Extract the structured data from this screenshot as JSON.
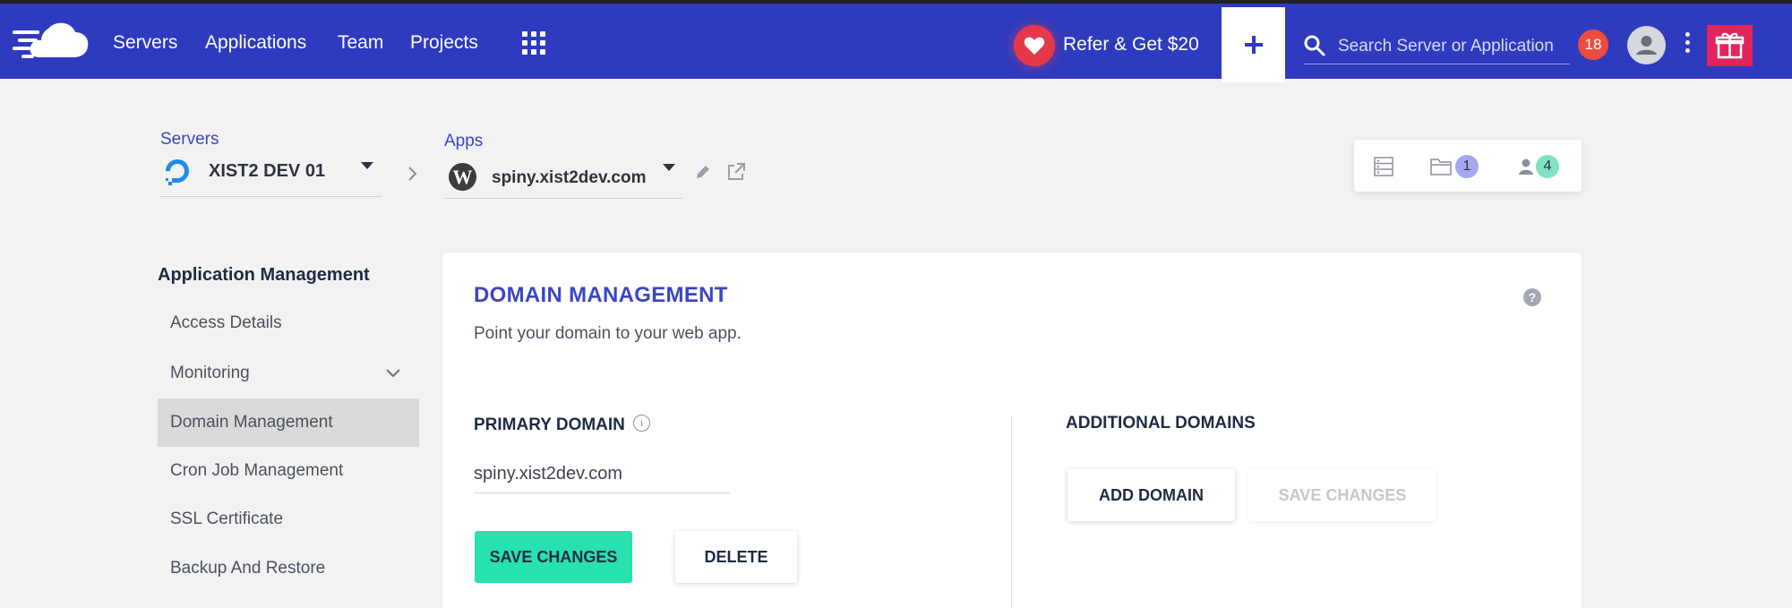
{
  "nav": {
    "links": [
      "Servers",
      "Applications",
      "Team",
      "Projects"
    ],
    "refer_label": "Refer & Get $20",
    "search_placeholder": "Search Server or Application",
    "notification_count": "18"
  },
  "breadcrumb": {
    "servers_label": "Servers",
    "server_name": "XIST2 DEV 01",
    "apps_label": "Apps",
    "app_name": "spiny.xist2dev.com"
  },
  "stats": {
    "folders_count": "1",
    "members_count": "4"
  },
  "sidebar": {
    "title": "Application Management",
    "items": [
      {
        "label": "Access Details"
      },
      {
        "label": "Monitoring"
      },
      {
        "label": "Domain Management"
      },
      {
        "label": "Cron Job Management"
      },
      {
        "label": "SSL Certificate"
      },
      {
        "label": "Backup And Restore"
      }
    ]
  },
  "card": {
    "title": "DOMAIN MANAGEMENT",
    "subtitle": "Point your domain to your web app.",
    "help_symbol": "?",
    "primary": {
      "label": "PRIMARY DOMAIN",
      "info_symbol": "i",
      "value": "spiny.xist2dev.com",
      "save_label": "SAVE CHANGES",
      "delete_label": "DELETE"
    },
    "additional": {
      "label": "ADDITIONAL DOMAINS",
      "add_label": "ADD DOMAIN",
      "save_label": "SAVE CHANGES"
    }
  },
  "colors": {
    "navbar": "#2f3bbf",
    "accent": "#27e1ae",
    "title": "#3a46c4",
    "badge_red": "#ee4b3f",
    "gift": "#e2245c"
  },
  "icons": [
    "cloudways-logo",
    "apps-grid-icon",
    "heart-icon",
    "plus-icon",
    "search-icon",
    "avatar-icon",
    "kebab-menu-icon",
    "gift-icon",
    "digitalocean-icon",
    "wordpress-icon",
    "pencil-icon",
    "external-link-icon",
    "server-list-icon",
    "folder-icon",
    "user-icon",
    "help-icon",
    "info-icon",
    "chevron-down-icon",
    "chevron-right-icon"
  ]
}
